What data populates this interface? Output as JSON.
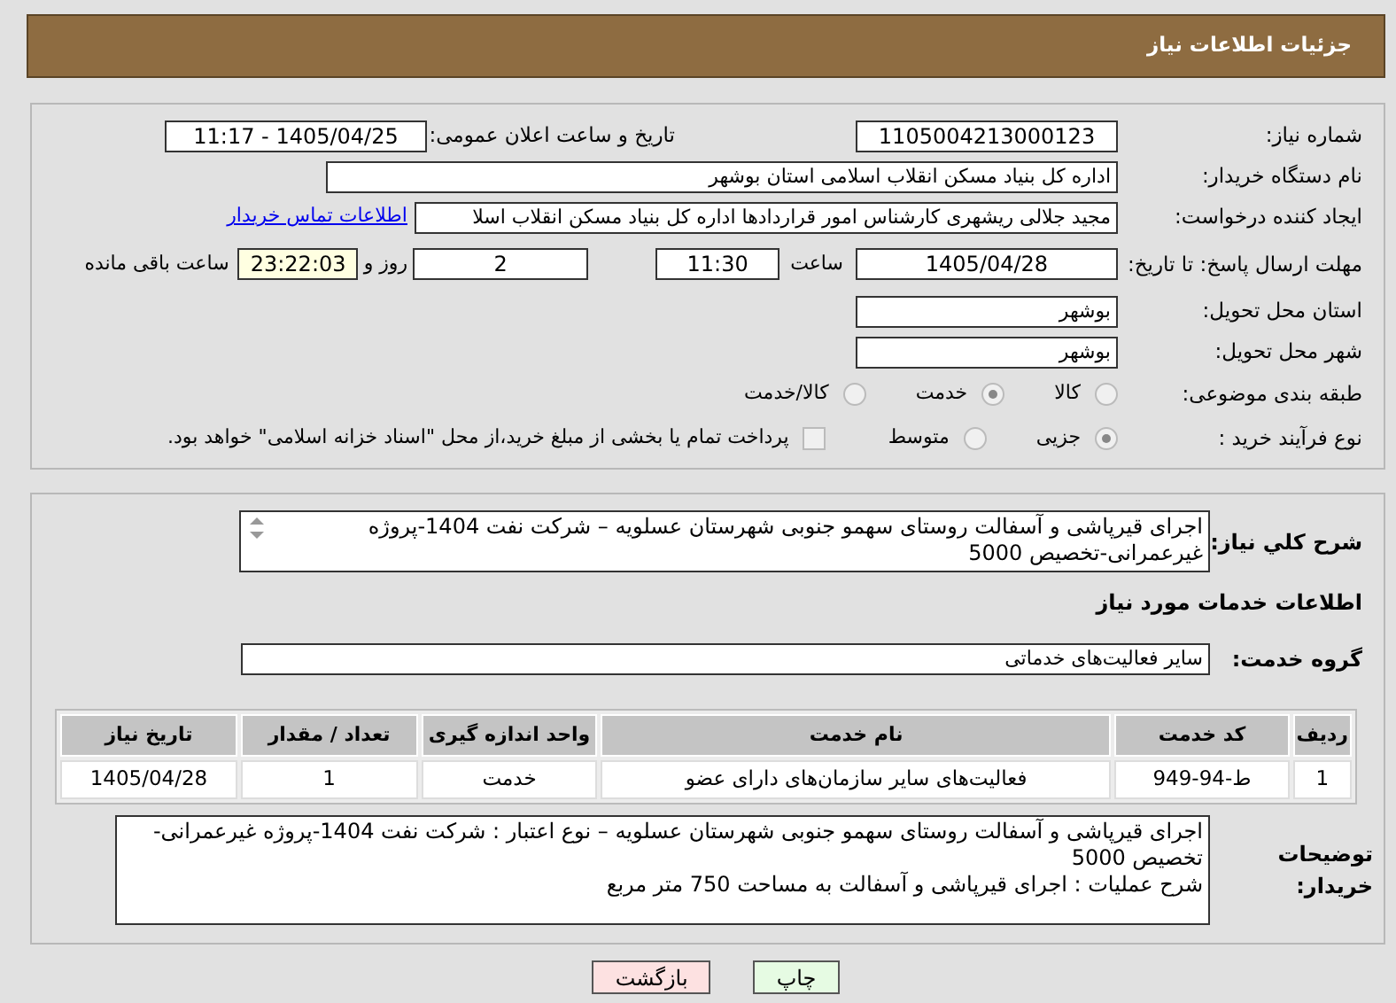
{
  "header": {
    "title": "جزئیات اطلاعات نیاز"
  },
  "need_number": {
    "label": "شماره نیاز:",
    "value": "1105004213000123"
  },
  "announce": {
    "label": "تاریخ و ساعت اعلان عمومی:",
    "value": "1405/04/25 - 11:17"
  },
  "buyer_org": {
    "label": "نام دستگاه خریدار:",
    "value": "اداره کل بنیاد مسکن انقلاب اسلامی استان بوشهر"
  },
  "requester": {
    "label": "ایجاد کننده درخواست:",
    "value": "مجید جلالی ریشهری کارشناس امور قراردادها اداره کل بنیاد مسکن انقلاب اسلا",
    "link": "اطلاعات تماس خریدار"
  },
  "deadline": {
    "label": "مهلت ارسال پاسخ: تا تاریخ:",
    "date": "1405/04/28",
    "time_label": "ساعت",
    "time": "11:30",
    "days": "2",
    "days_label": "روز و",
    "remaining": "23:22:03",
    "remaining_label": "ساعت باقی مانده"
  },
  "province": {
    "label": "استان محل تحویل:",
    "value": "بوشهر"
  },
  "city": {
    "label": "شهر محل تحویل:",
    "value": "بوشهر"
  },
  "category": {
    "label": "طبقه بندی موضوعی:",
    "options": [
      {
        "label": "کالا",
        "selected": false
      },
      {
        "label": "خدمت",
        "selected": true
      },
      {
        "label": "کالا/خدمت",
        "selected": false
      }
    ]
  },
  "process": {
    "label": "نوع فرآیند خرید :",
    "options": [
      {
        "label": "جزیی",
        "selected": true
      },
      {
        "label": "متوسط",
        "selected": false
      }
    ],
    "payment": {
      "label": "پرداخت تمام یا بخشی از مبلغ خرید،از محل \"اسناد خزانه اسلامی\" خواهد بود.",
      "checked": false
    }
  },
  "description": {
    "label": "شرح کلي نياز:",
    "text": "اجرای قیرپاشی و آسفالت روستای سهمو جنوبی شهرستان عسلویه –  شرکت نفت 1404-پروژه غیرعمرانی-تخصیص 5000"
  },
  "services_title": "اطلاعات خدمات مورد نياز",
  "service_group": {
    "label": "گروه خدمت:",
    "value": "سایر فعالیت‌های خدماتی"
  },
  "table": {
    "columns": [
      "ردیف",
      "کد خدمت",
      "نام خدمت",
      "واحد اندازه گیری",
      "تعداد / مقدار",
      "تاریخ نیاز"
    ],
    "rows": [
      [
        "1",
        "ط-94-949",
        "فعالیت‌های سایر سازمان‌های دارای عضو",
        "خدمت",
        "1",
        "1405/04/28"
      ]
    ]
  },
  "notes": {
    "label": "توضیحات خریدار:",
    "lines": [
      "اجرای قیرپاشی و آسفالت روستای سهمو جنوبی شهرستان عسلویه – نوع اعتبار : شرکت نفت 1404-پروژه غیرعمرانی-تخصیص 5000",
      "شرح عملیات : اجرای قیرپاشی و آسفالت به مساحت 750 متر مربع"
    ]
  },
  "buttons": [
    {
      "label": "چاپ",
      "kind": "print"
    },
    {
      "label": "بازگشت",
      "kind": "back"
    }
  ]
}
